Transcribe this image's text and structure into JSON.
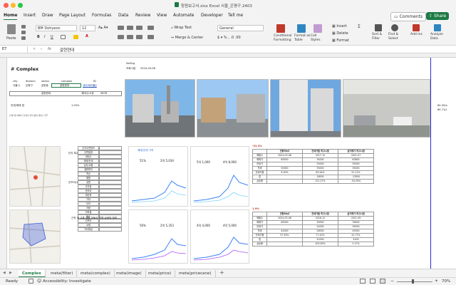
{
  "window": {
    "title": "창원보고서.xlsx Excel 서울_은평구.2403",
    "colors": {
      "accent": "#1d7a45",
      "header": "#f3f3f3"
    }
  },
  "ribbon": {
    "tabs": [
      "Home",
      "Insert",
      "Draw",
      "Page Layout",
      "Formulas",
      "Data",
      "Review",
      "View",
      "Automate",
      "Developer",
      "Tell me"
    ],
    "active_tab": "Home",
    "comments_label": "Comments",
    "share_label": "Share",
    "paste_label": "Paste",
    "font_name": "BM Dohyeon",
    "font_size": "12",
    "wrap_text": "Wrap Text",
    "merge_center": "Merge & Center",
    "number_format": "General",
    "cond_format": "Conditional Formatting",
    "format_table": "Format as Table",
    "cell_styles": "Cell Styles",
    "insert": "Insert",
    "delete": "Delete",
    "format": "Format",
    "sort_filter": "Sort & Filter",
    "find_select": "Find & Select",
    "add_ins": "Add-ins",
    "analyze": "Analyze Data"
  },
  "formula_bar": {
    "cell_ref": "E7",
    "fx": "fx",
    "value": "갈현현대"
  },
  "sheet": {
    "title": "# Complex",
    "selling_label": "Selling",
    "date_label": "조회시점",
    "date_value": "2024-03-08",
    "info_headers": [
      "city",
      "division",
      "sector",
      "complex",
      "ID"
    ],
    "info_values": [
      "서울시",
      "은평구",
      "갈현동",
      "갈현현대",
      "1"
    ],
    "link_text": "네이버부동산",
    "row2": [
      "갈현현대",
      "",
      "세대수/시공",
      "4678"
    ],
    "row3_label": "전세/매매 갭",
    "row3": [
      "",
      "",
      "",
      "",
      "",
      "1.00%"
    ],
    "tiny_line": "전세가율 매매가 전세가 면적 평형 세대수 입주",
    "side_right": [
      "84.35/a",
      "84.71/c"
    ],
    "side_note": "근처 내 교통 생활 부동산 주변 상권의 정보",
    "section1_label": "단지 특성",
    "section2_label": "인프라/교통",
    "features": [
      "단지주변정보",
      "주변환경",
      "세대수",
      "매매/전세",
      "입지/교통",
      "생활편의",
      "학군",
      "병원",
      "공원",
      "주차장",
      "관리비",
      "재건축",
      "기타"
    ],
    "features2": [
      "도보",
      "차량",
      "지하철",
      "버스",
      "인프라",
      "쇼핑",
      "기타특징"
    ],
    "chart1": {
      "legend": "매매/전세 가격",
      "pct": "51%",
      "price": "2억 5,034"
    },
    "chart2": {
      "price": "5억 1,000",
      "alt": "4억 8,000",
      "max": "7억"
    },
    "chart3": {
      "pct": "56%",
      "price": "2억 5,353"
    },
    "chart4": {
      "price": "4억 4,000",
      "alt": "4억 5,000"
    },
    "table1": {
      "badge": "-31.3%",
      "headers": [
        "",
        "전용59㎡",
        "전세가율 최고시점",
        "실거래가 최고시점"
      ],
      "rows": [
        [
          "매물수",
          "2024-03-08",
          "2017-12",
          "2021-07"
        ],
        [
          "매매가",
          "60000",
          "34000",
          "63800"
        ],
        [
          "전세가",
          "",
          "25000",
          "35000"
        ],
        [
          "월세",
          "50000",
          "35000",
          "35000"
        ],
        [
          "전세가율",
          "9.00%",
          "65.44%",
          "51.11%"
        ],
        [
          "갭",
          "",
          "18000",
          "-13500"
        ],
        [
          "상승률",
          "",
          "121.27%",
          "-54.29%"
        ]
      ]
    },
    "table2": {
      "badge": "1.9%",
      "headers": [
        "",
        "전용84㎡",
        "전세가율 최고시점",
        "실거래가 최고시점"
      ],
      "rows": [
        [
          "매물수",
          "2024-03-08",
          "2016-12",
          "2021-09"
        ],
        [
          "매매가",
          "60000",
          "30000",
          "78000"
        ],
        [
          "전세가",
          "",
          "24000",
          "39000"
        ],
        [
          "월세",
          "42000",
          "28000",
          "45000"
        ],
        [
          "전세가율",
          "57.50%",
          "77.42%",
          "41.77%"
        ],
        [
          "갭",
          "",
          "41000",
          "4100"
        ],
        [
          "상승률",
          "",
          "105.90%",
          "2.17%"
        ]
      ]
    }
  },
  "sheet_tabs": [
    "Complex",
    "meta(filter)",
    "meta(complex)",
    "meta(image)",
    "meta(price)",
    "meta(pricecane)"
  ],
  "active_sheet": "Complex",
  "status": {
    "ready": "Ready",
    "accessibility": "Accessibility: Investigate",
    "zoom": "70%"
  }
}
